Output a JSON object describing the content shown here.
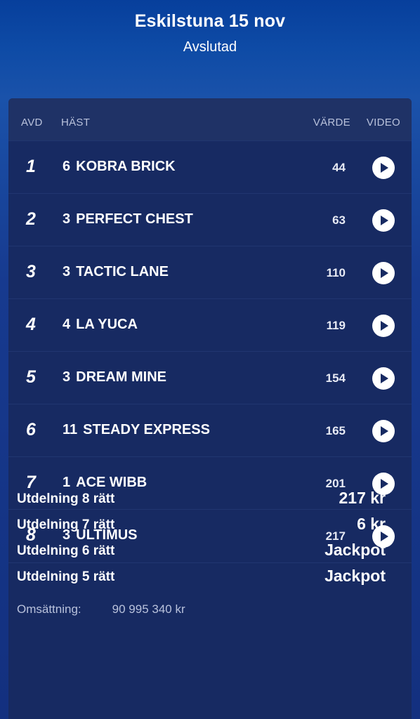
{
  "header": {
    "title": "Eskilstuna 15 nov",
    "status": "Avslutad"
  },
  "table": {
    "columns": {
      "avd": "AVD",
      "horse": "HÄST",
      "value": "VÄRDE",
      "video": "VIDEO"
    },
    "rows": [
      {
        "avd": "1",
        "number": "6",
        "name": "KOBRA BRICK",
        "value": "44"
      },
      {
        "avd": "2",
        "number": "3",
        "name": "PERFECT CHEST",
        "value": "63"
      },
      {
        "avd": "3",
        "number": "3",
        "name": "TACTIC LANE",
        "value": "110"
      },
      {
        "avd": "4",
        "number": "4",
        "name": "LA YUCA",
        "value": "119"
      },
      {
        "avd": "5",
        "number": "3",
        "name": "DREAM MINE",
        "value": "154"
      },
      {
        "avd": "6",
        "number": "11",
        "name": "STEADY EXPRESS",
        "value": "165"
      },
      {
        "avd": "7",
        "number": "1",
        "name": "ACE WIBB",
        "value": "201"
      },
      {
        "avd": "8",
        "number": "3",
        "name": "ULTIMUS",
        "value": "217"
      }
    ],
    "video_icon": "play-icon"
  },
  "payouts": [
    {
      "label": "Utdelning 8 rätt",
      "amount": "217 kr"
    },
    {
      "label": "Utdelning 7 rätt",
      "amount": "6 kr"
    },
    {
      "label": "Utdelning 6 rätt",
      "amount": "Jackpot"
    },
    {
      "label": "Utdelning 5 rätt",
      "amount": "Jackpot"
    }
  ],
  "turnover": {
    "label": "Omsättning:",
    "value": "90 995 340 kr"
  },
  "colors": {
    "header_gradient_top": "#073f9c",
    "card_background": "#172a62",
    "text": "#ffffff",
    "muted_text": "#b9c2dc"
  }
}
